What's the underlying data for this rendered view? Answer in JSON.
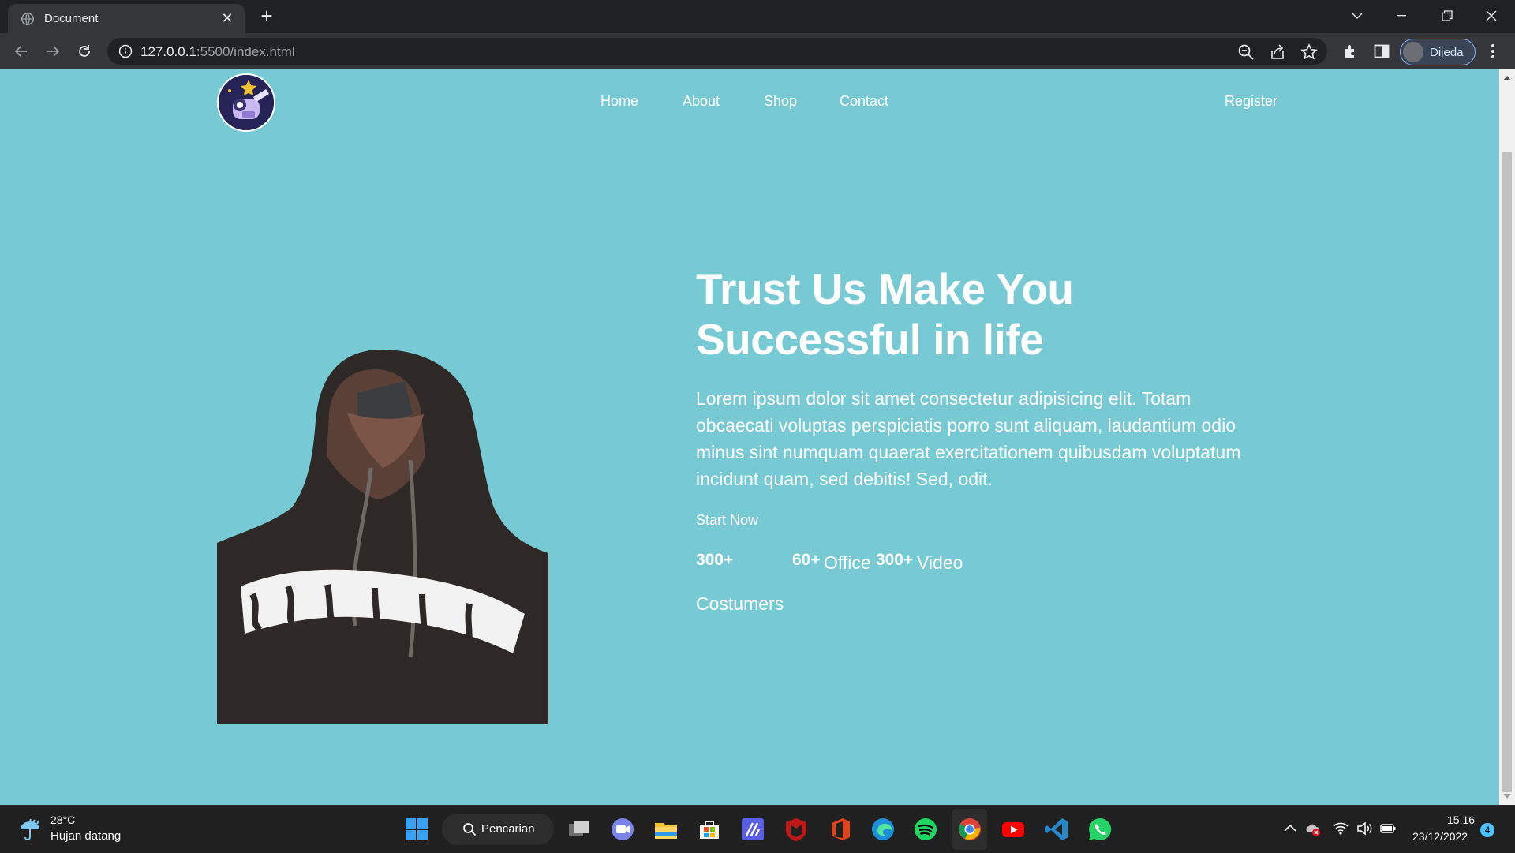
{
  "browser": {
    "tab_title": "Document",
    "url_host": "127.0.0.1",
    "url_rest": ":5500/index.html",
    "profile_name": "Dijeda"
  },
  "site": {
    "nav": [
      "Home",
      "About",
      "Shop",
      "Contact"
    ],
    "register_label": "Register",
    "hero_title_line1": "Trust Us Make You",
    "hero_title_line2": "Successful in life",
    "hero_text": "Lorem ipsum dolor sit amet consectetur adipisicing elit. Totam obcaecati voluptas perspiciatis porro sunt aliquam, laudantium odio minus sint numquam quaerat exercitationem quibusdam voluptatum incidunt quam, sed debitis! Sed, odit.",
    "start_label": "Start Now",
    "stats": [
      {
        "value": "300+",
        "label": "Costumers"
      },
      {
        "value": "60+",
        "label": "Office"
      },
      {
        "value": "300+",
        "label": "Video"
      }
    ],
    "accent_color": "#77c9d4"
  },
  "taskbar": {
    "temperature": "28°C",
    "weather": "Hujan datang",
    "search_label": "Pencarian",
    "time": "15.16",
    "date": "23/12/2022",
    "notification_count": "4"
  }
}
